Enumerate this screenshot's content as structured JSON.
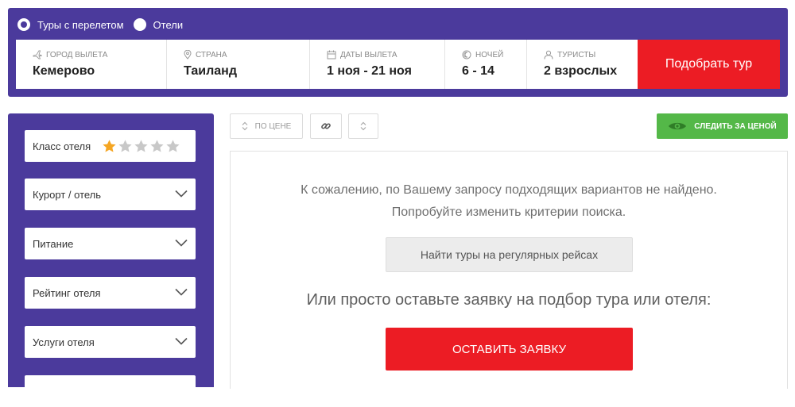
{
  "search": {
    "modes": [
      {
        "label": "Туры с перелетом",
        "selected": true
      },
      {
        "label": "Отели",
        "selected": false
      }
    ],
    "fields": {
      "departure_city": {
        "label": "ГОРОД ВЫЛЕТА",
        "value": "Кемерово",
        "icon": "plane-icon"
      },
      "country": {
        "label": "СТРАНА",
        "value": "Таиланд",
        "icon": "location-pin-icon"
      },
      "dates": {
        "label": "ДАТЫ ВЫЛЕТА",
        "value": "1 ноя - 21 ноя",
        "icon": "calendar-icon"
      },
      "nights": {
        "label": "НОЧЕЙ",
        "value": "6 - 14",
        "icon": "moon-icon"
      },
      "tourists": {
        "label": "ТУРИСТЫ",
        "value": "2 взрослых",
        "icon": "user-icon"
      }
    },
    "submit_label": "Подобрать тур"
  },
  "sidebar": {
    "hotel_class": {
      "label": "Класс отеля",
      "stars": 5,
      "selected_stars": 1
    },
    "filters": [
      "Курорт / отель",
      "Питание",
      "Рейтинг отеля",
      "Услуги отеля"
    ]
  },
  "toolbar": {
    "sort_price_label": "ПО ЦЕНЕ",
    "track_price_label": "СЛЕДИТЬ ЗА ЦЕНОЙ"
  },
  "results": {
    "no_results_line1": "К сожалению, по Вашему запросу подходящих вариантов не найдено.",
    "no_results_line2": "Попробуйте изменить критерии поиска.",
    "regular_flights_label": "Найти туры на регулярных рейсах",
    "request_prompt": "Или просто оставьте заявку на подбор тура или отеля:",
    "request_button_label": "Оставить заявку"
  },
  "colors": {
    "brand_purple": "#4b3a9c",
    "accent_red": "#ec1c24",
    "accent_green": "#54b848",
    "star_active": "#f5a623",
    "star_inactive": "#c8c8c8"
  }
}
